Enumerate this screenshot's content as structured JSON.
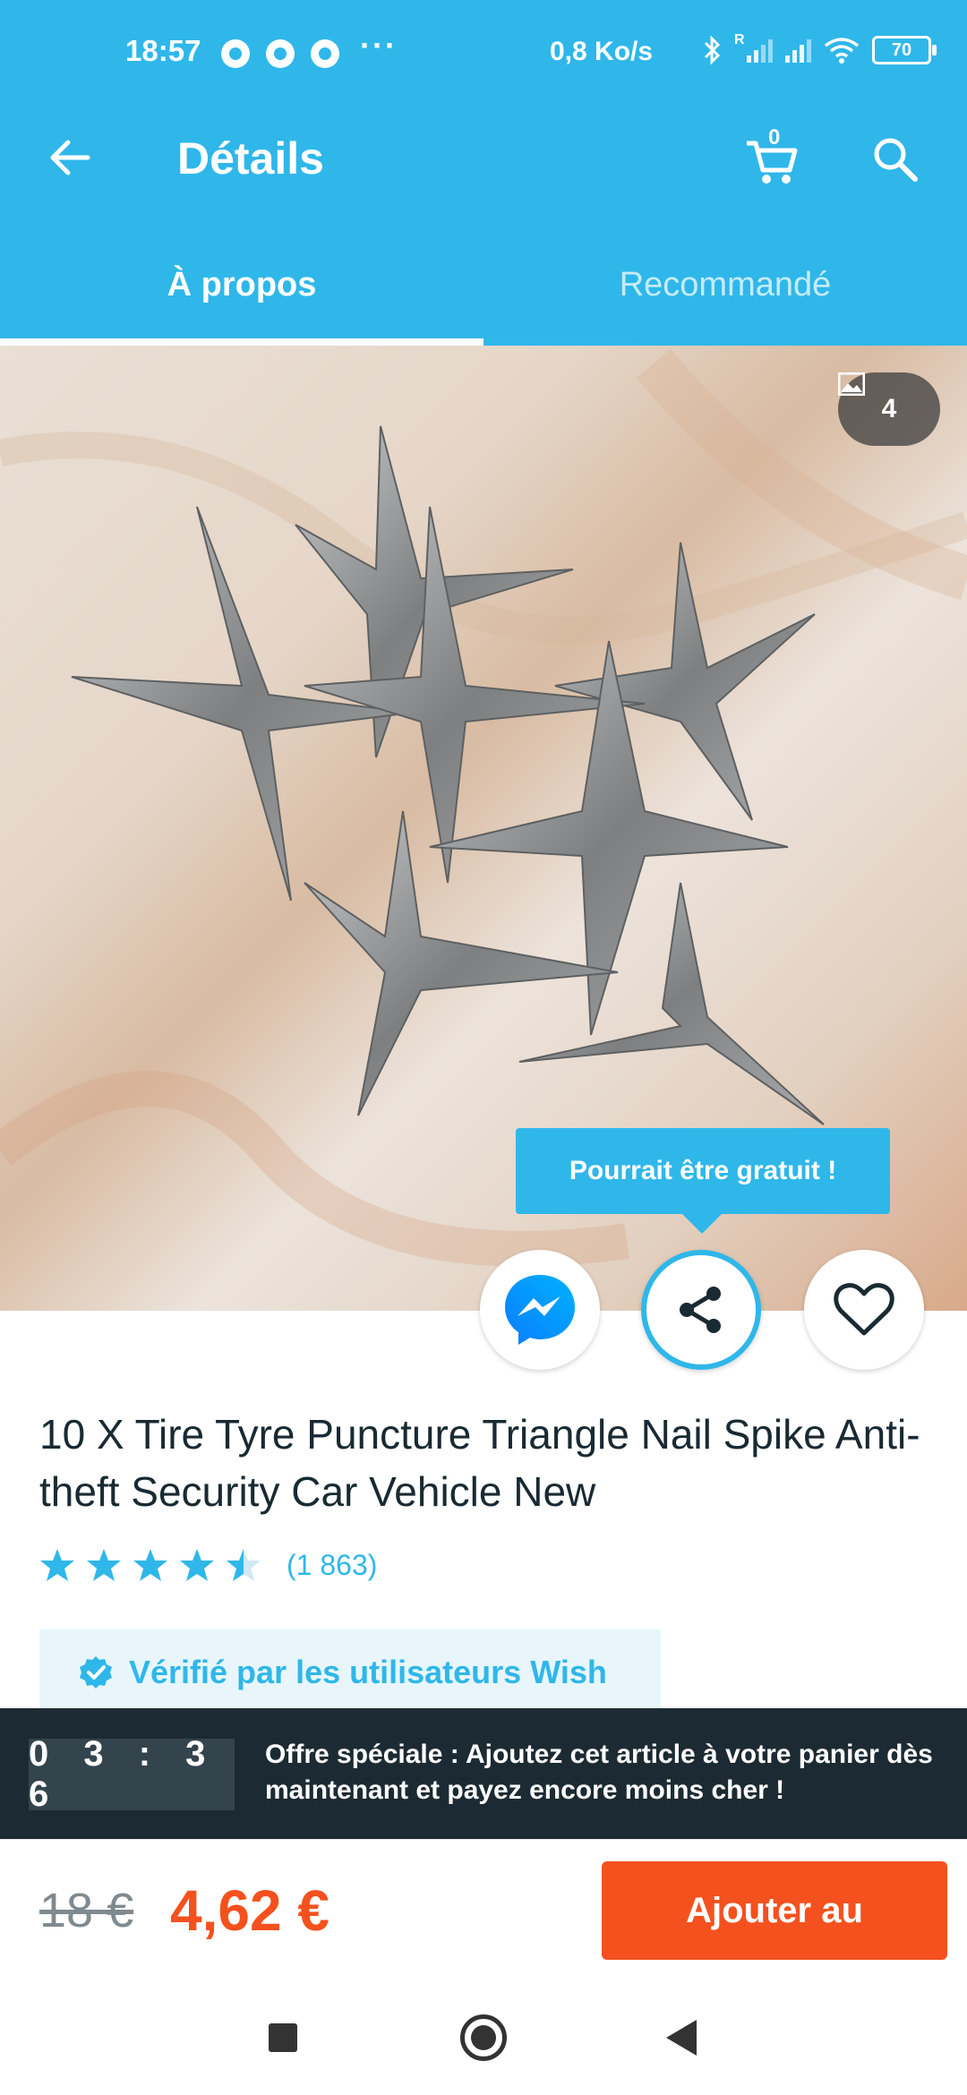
{
  "status_bar": {
    "time": "18:57",
    "more": "···",
    "speed": "0,8 Ko/s",
    "battery": "70",
    "signal_roaming": "R",
    "icons": [
      "chrome-icon",
      "chrome-icon",
      "chrome-icon",
      "bluetooth-icon",
      "signal-icon",
      "signal-icon",
      "wifi-icon",
      "battery-icon"
    ]
  },
  "app_bar": {
    "title": "Détails",
    "cart_count": "0",
    "icons": [
      "back-arrow-icon",
      "cart-icon",
      "search-icon"
    ]
  },
  "tabs": [
    {
      "label": "À propos",
      "active": true
    },
    {
      "label": "Recommandé",
      "active": false
    }
  ],
  "product_image": {
    "image_count": "4",
    "icons": [
      "image-icon"
    ]
  },
  "tooltip": {
    "text": "Pourrait être gratuit !"
  },
  "actions": {
    "icons": [
      "messenger-icon",
      "share-icon",
      "heart-icon"
    ]
  },
  "product": {
    "title": "10 X Tire Tyre Puncture Triangle Nail Spike Anti-theft Security Car Vehicle New",
    "rating": 4.5,
    "rating_count": "(1 863)",
    "verified_label": "Vérifié par les utilisateurs Wish"
  },
  "offer": {
    "timer": "03:36",
    "text": "Offre spéciale : Ajoutez cet article à votre panier dès maintenant et payez encore moins cher !"
  },
  "buy_bar": {
    "old_price": "18 €",
    "new_price": "4,62 €",
    "add_button": "Ajouter au"
  },
  "colors": {
    "accent": "#2fb7ea",
    "price": "#f4511e",
    "dark": "#1c2b33"
  }
}
